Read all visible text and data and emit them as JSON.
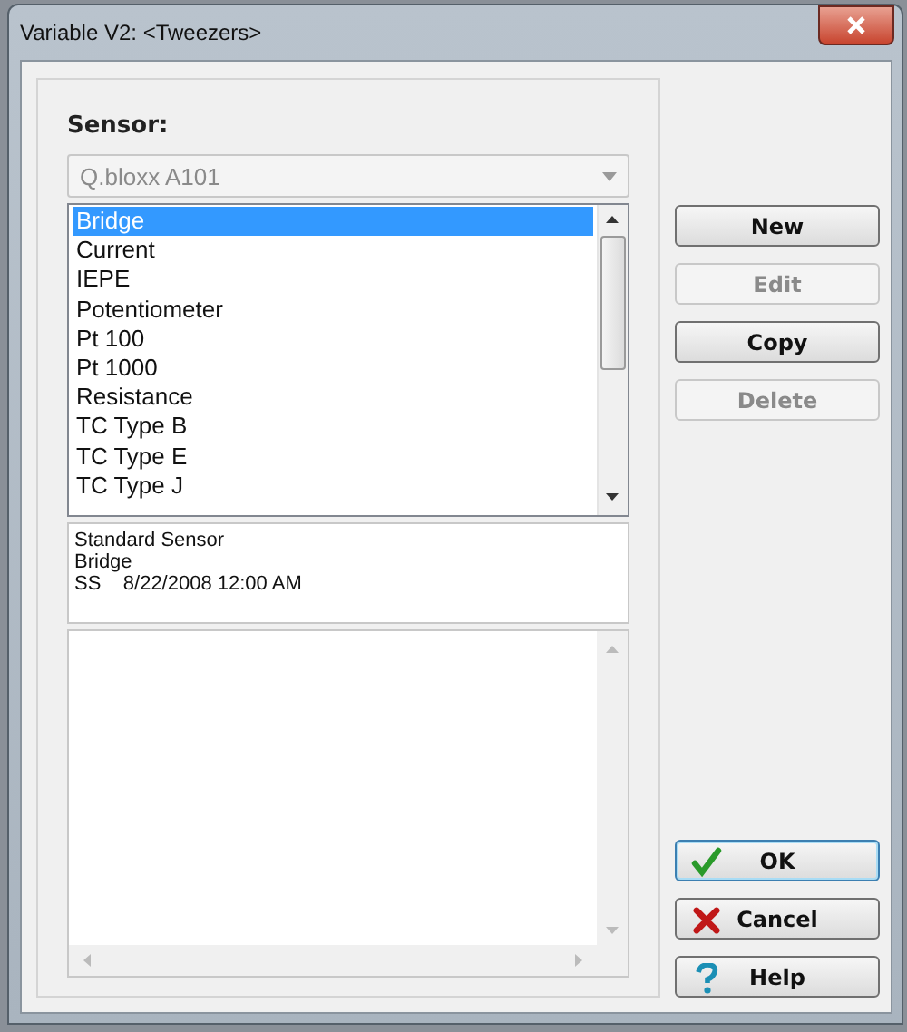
{
  "window": {
    "title": "Variable V2: <Tweezers>"
  },
  "sensor": {
    "label": "Sensor:",
    "dropdown": {
      "value": "Q.bloxx A101",
      "disabled": true
    },
    "list": [
      {
        "label": "Bridge",
        "selected": true
      },
      {
        "label": "Current",
        "selected": false
      },
      {
        "label": "IEPE",
        "selected": false
      },
      {
        "label": "Potentiometer",
        "selected": false
      },
      {
        "label": "Pt 100",
        "selected": false
      },
      {
        "label": "Pt 1000",
        "selected": false
      },
      {
        "label": "Resistance",
        "selected": false
      },
      {
        "label": "TC Type B",
        "selected": false
      },
      {
        "label": "TC Type E",
        "selected": false
      },
      {
        "label": "TC Type J",
        "selected": false
      }
    ],
    "info": [
      "Standard Sensor",
      "Bridge",
      "SS    8/22/2008 12:00 AM"
    ]
  },
  "side_buttons": [
    {
      "label": "New",
      "disabled": false
    },
    {
      "label": "Edit",
      "disabled": true
    },
    {
      "label": "Copy",
      "disabled": false
    },
    {
      "label": "Delete",
      "disabled": true
    }
  ],
  "dialog_buttons": [
    {
      "label": "OK",
      "kind": "ok"
    },
    {
      "label": "Cancel",
      "kind": "cancel"
    },
    {
      "label": "Help",
      "kind": "help"
    }
  ]
}
